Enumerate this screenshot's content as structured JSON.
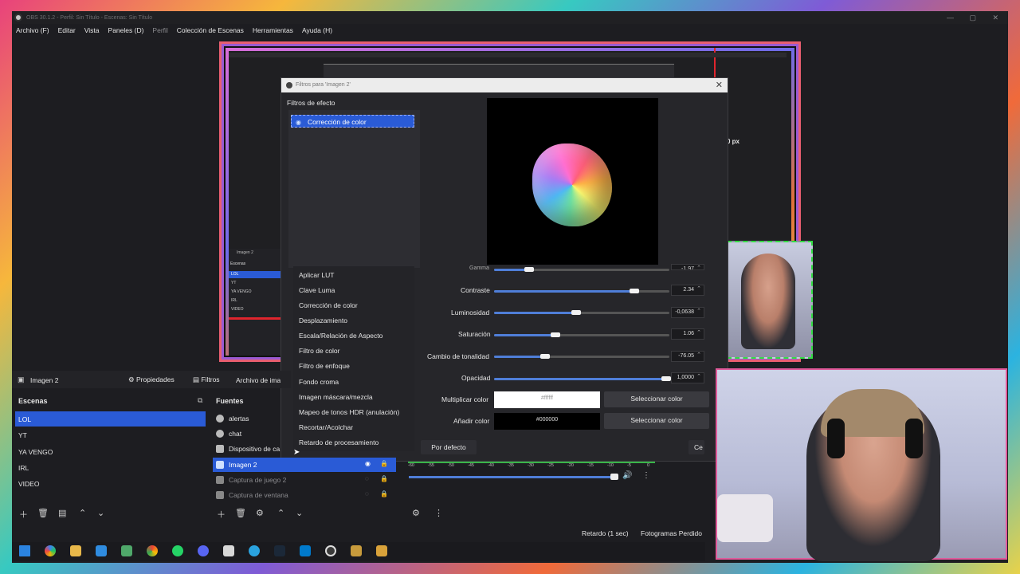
{
  "window": {
    "title": "OBS 30.1.2 - Perfil: Sin Título - Escenas: Sin Título"
  },
  "menu": [
    "Archivo (F)",
    "Editar",
    "Vista",
    "Paneles (D)",
    "Perfil",
    "Colección de Escenas",
    "Herramientas",
    "Ayuda (H)"
  ],
  "dialog": {
    "title": "Filtros para 'Imagen 2'",
    "effects_label": "Filtros de efecto",
    "selected_filter": "Corrección de color"
  },
  "add_menu": [
    "Aplicar LUT",
    "Clave Luma",
    "Corrección de color",
    "Desplazamiento",
    "Escala/Relación de Aspecto",
    "Filtro de color",
    "Filtro de enfoque",
    "Fondo croma",
    "Imagen máscara/mezcla",
    "Mapeo de tonos HDR (anulación)",
    "Recortar/Acolchar",
    "Retardo de procesamiento"
  ],
  "properties": {
    "gamma": {
      "label": "Gamma",
      "value": "-1.97",
      "level": 0.2
    },
    "contraste": {
      "label": "Contraste",
      "value": "2.34",
      "level": 0.8
    },
    "luminosidad": {
      "label": "Luminosidad",
      "value": "-0,0638",
      "level": 0.47
    },
    "saturacion": {
      "label": "Saturación",
      "value": "1.06",
      "level": 0.35
    },
    "tonalidad": {
      "label": "Cambio de tonalidad",
      "value": "-76.05",
      "level": 0.29
    },
    "opacidad": {
      "label": "Opacidad",
      "value": "1,0000",
      "level": 0.98
    },
    "multiplicar": {
      "label": "Multiplicar color",
      "value": "#ffffff",
      "button": "Seleccionar color"
    },
    "anadir": {
      "label": "Añadir color",
      "value": "#000000",
      "button": "Seleccionar color"
    }
  },
  "buttons": {
    "defaults": "Por defecto",
    "close": "Ce"
  },
  "source_toolbar": {
    "selected": "Imagen 2",
    "properties": "Propiedades",
    "filters": "Filtros",
    "image_file": "Archivo de ima"
  },
  "scenes": {
    "title": "Escenas",
    "items": [
      "LOL",
      "YT",
      "YA VENGO",
      "IRL",
      "VIDEO"
    ]
  },
  "sources": {
    "title": "Fuentes",
    "items": [
      "alertas",
      "chat",
      "Dispositivo de ca",
      "Imagen 2",
      "Captura de juego 2",
      "Captura de ventana"
    ]
  },
  "canvas_px": "0 px",
  "mixer": {
    "ticks": [
      "-60",
      "-55",
      "-50",
      "-45",
      "-40",
      "-35",
      "-30",
      "-25",
      "-20",
      "-15",
      "-10",
      "-5",
      "0"
    ]
  },
  "status": {
    "delay": "Retardo (1 sec)",
    "frames": "Fotogramas Perdido"
  },
  "preview_mini": {
    "title": "Imagen 2",
    "scenes_label": "Escenas",
    "items": [
      "LOL",
      "YT",
      "YA VENGO",
      "IRL",
      "VIDEO"
    ]
  },
  "colors": {
    "accent": "#2a5bd6",
    "bg": "#1d1d21"
  }
}
